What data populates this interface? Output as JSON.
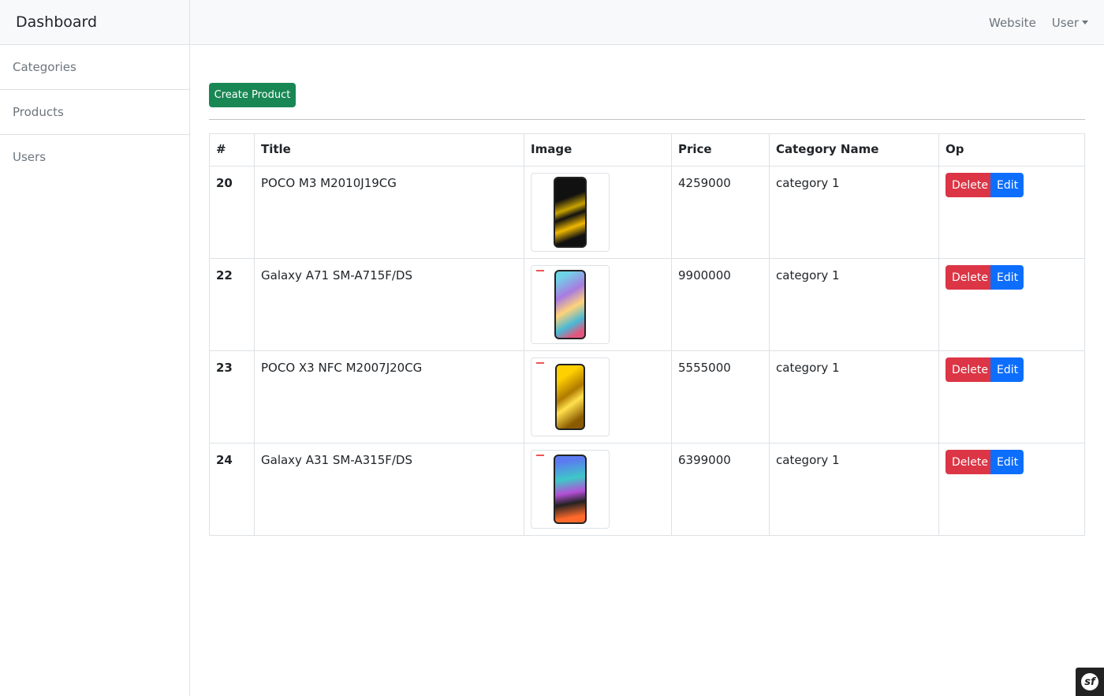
{
  "sidebar": {
    "brand": "Dashboard",
    "items": [
      {
        "label": "Categories"
      },
      {
        "label": "Products"
      },
      {
        "label": "Users"
      }
    ]
  },
  "topbar": {
    "website_label": "Website",
    "user_label": "User"
  },
  "main": {
    "create_label": "Create Product",
    "table": {
      "headers": [
        "#",
        "Title",
        "Image",
        "Price",
        "Category Name",
        "Op"
      ],
      "rows": [
        {
          "id": "20",
          "title": "POCO M3 M2010J19CG",
          "price": "4259000",
          "category": "category 1",
          "delete_label": "Delete",
          "edit_label": "Edit"
        },
        {
          "id": "22",
          "title": "Galaxy A71 SM-A715F/DS",
          "price": "9900000",
          "category": "category 1",
          "delete_label": "Delete",
          "edit_label": "Edit"
        },
        {
          "id": "23",
          "title": "POCO X3 NFC M2007J20CG",
          "price": "5555000",
          "category": "category 1",
          "delete_label": "Delete",
          "edit_label": "Edit"
        },
        {
          "id": "24",
          "title": "Galaxy A31 SM-A315F/DS",
          "price": "6399000",
          "category": "category 1",
          "delete_label": "Delete",
          "edit_label": "Edit"
        }
      ]
    }
  },
  "colors": {
    "primary": "#0d6efd",
    "danger": "#dc3545",
    "success": "#198754"
  },
  "icons": {
    "debug_toolbar": "symfony-icon",
    "user_dropdown": "caret-down-icon"
  }
}
